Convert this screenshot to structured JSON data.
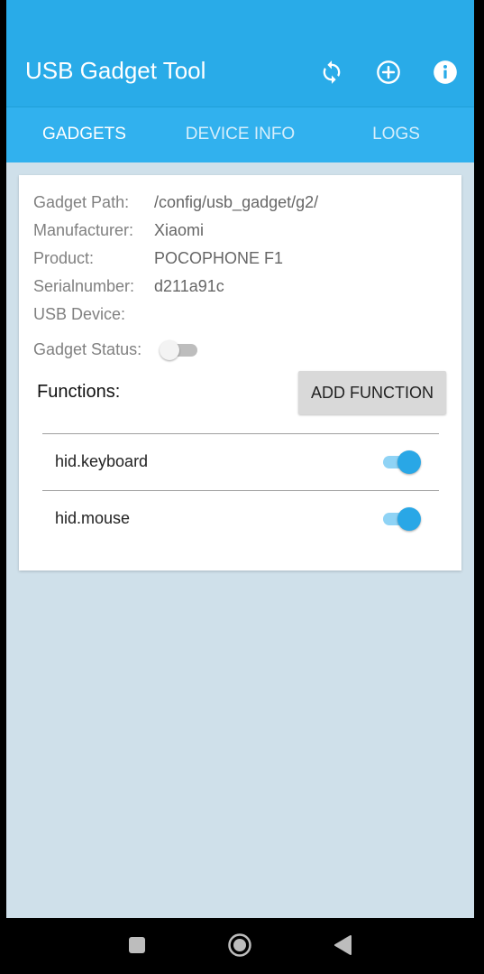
{
  "app": {
    "title": "USB Gadget Tool",
    "colors": {
      "appbar": "#29abe8",
      "tabs": "#31b1ee",
      "accent": "#29a7e6",
      "background": "#cfe0ea"
    },
    "actions": [
      {
        "icon": "refresh-icon"
      },
      {
        "icon": "add-circle-icon"
      },
      {
        "icon": "info-icon"
      }
    ]
  },
  "tabs": [
    {
      "label": "GADGETS",
      "active": true
    },
    {
      "label": "DEVICE INFO",
      "active": false
    },
    {
      "label": "LOGS",
      "active": false
    }
  ],
  "gadget": {
    "path_label": "Gadget Path:",
    "path_value": "/config/usb_gadget/g2/",
    "manufacturer_label": "Manufacturer:",
    "manufacturer_value": "Xiaomi",
    "product_label": "Product:",
    "product_value": "POCOPHONE F1",
    "serial_label": "Serialnumber:",
    "serial_value": "d211a91c",
    "usb_device_label": "USB Device:",
    "usb_device_value": "",
    "status_label": "Gadget Status:",
    "status_enabled": false
  },
  "functions": {
    "label": "Functions:",
    "add_button_label": "ADD FUNCTION",
    "items": [
      {
        "name": "hid.keyboard",
        "enabled": true
      },
      {
        "name": "hid.mouse",
        "enabled": true
      }
    ]
  },
  "navbar": {
    "buttons": [
      {
        "icon": "recents-square-icon"
      },
      {
        "icon": "home-circle-icon"
      },
      {
        "icon": "back-triangle-icon"
      }
    ]
  }
}
